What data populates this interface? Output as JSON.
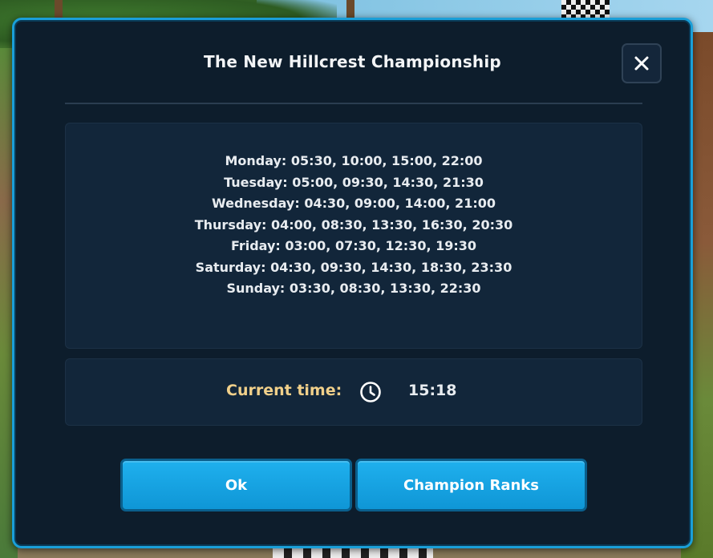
{
  "dialog": {
    "title": "The New Hillcrest Championship",
    "close_icon": "close-icon"
  },
  "schedule": [
    {
      "line": "Monday: 05:30, 10:00, 15:00, 22:00"
    },
    {
      "line": "Tuesday: 05:00, 09:30, 14:30, 21:30"
    },
    {
      "line": "Wednesday: 04:30, 09:00, 14:00, 21:00"
    },
    {
      "line": "Thursday: 04:00, 08:30, 13:30, 16:30, 20:30"
    },
    {
      "line": "Friday: 03:00, 07:30, 12:30, 19:30"
    },
    {
      "line": "Saturday: 04:30, 09:30, 14:30, 18:30, 23:30"
    },
    {
      "line": "Sunday: 03:30, 08:30, 13:30, 22:30"
    }
  ],
  "current_time": {
    "label": "Current time:",
    "icon": "clock-icon",
    "value": "15:18"
  },
  "buttons": {
    "ok_label": "Ok",
    "ranks_label": "Champion Ranks"
  },
  "colors": {
    "dialog_bg": "#0d1d2c",
    "dialog_border": "#1a9fd8",
    "panel_bg": "#12263a",
    "button_blue": "#1fb0ee",
    "time_label": "#f1d08a"
  }
}
